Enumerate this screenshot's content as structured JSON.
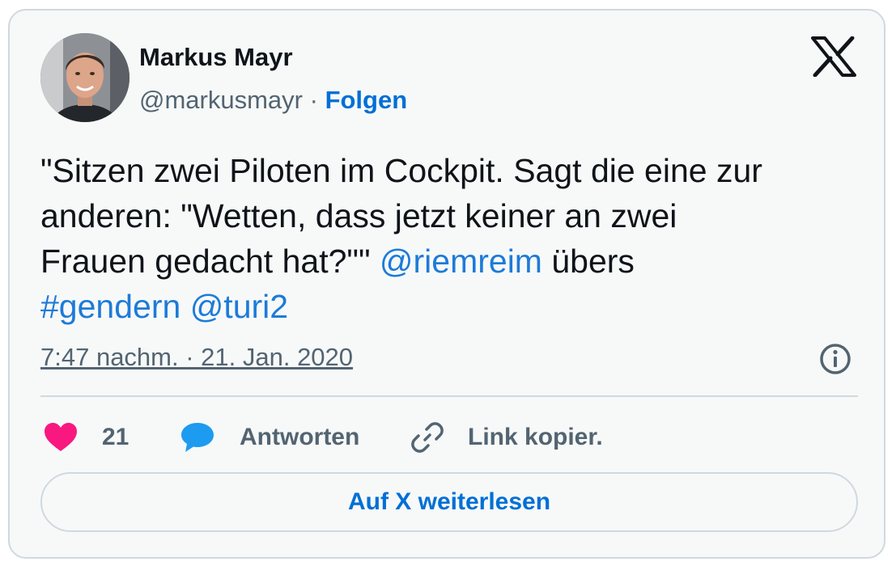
{
  "author": {
    "name": "Markus Mayr",
    "handle": "@markusmayr",
    "separator": "·",
    "follow_label": "Folgen"
  },
  "tweet": {
    "line1": "\"Sitzen zwei Piloten im Cockpit. Sagt die eine zur",
    "line2": "anderen: \"Wetten, dass jetzt keiner an zwei",
    "line3_text": "Frauen gedacht hat?\"\"",
    "mention1": "@riemreim",
    "line3_after": "übers",
    "hashtag": "#gendern",
    "mention2": "@turi2",
    "timestamp": "7:47 nachm. · 21. Jan. 2020"
  },
  "actions": {
    "like_count": "21",
    "reply_label": "Antworten",
    "copy_link_label": "Link kopier."
  },
  "read_more_label": "Auf X weiterlesen",
  "icons": {
    "logo": "x-logo-icon",
    "info": "info-icon",
    "like": "heart-icon",
    "reply": "speech-bubble-icon",
    "copy_link": "link-icon"
  },
  "colors": {
    "link": "#1d7bd8",
    "follow": "#006fd6",
    "heart": "#f91880",
    "reply_bubble": "#1d9bf0",
    "muted_text": "#536471",
    "card_background": "#f7f9f9",
    "border": "#cfd9de"
  }
}
